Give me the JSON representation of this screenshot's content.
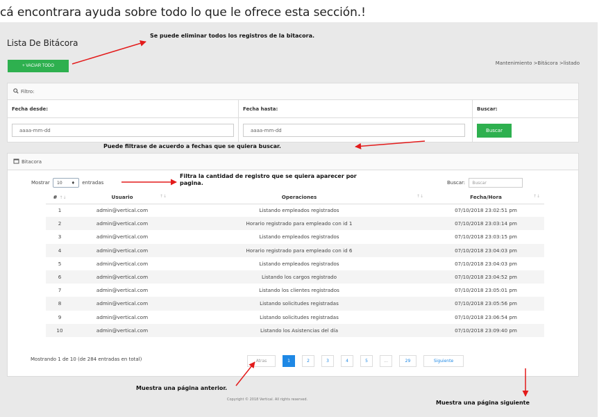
{
  "intro": "cá encontrara ayuda sobre todo lo que le ofrece esta sección.!",
  "page_title": "Lista De Bitácora",
  "vaciar_button": "+ VACIAR TODO",
  "breadcrumb": "Mantenimiento >Bitácora >listado",
  "filter": {
    "header": "Filtro:",
    "col_desde": "Fecha desde:",
    "col_hasta": "Fecha hasta:",
    "col_buscar": "Buscar:",
    "desde_placeholder": "aaaa-mm-dd",
    "hasta_placeholder": "aaaa-mm-dd",
    "buscar_button": "Buscar"
  },
  "bitacora": {
    "header": "Bitacora",
    "mostrar_label": "Mostrar",
    "entries_value": "10",
    "entradas_label": "entradas",
    "buscar_label": "Buscar:",
    "search_placeholder": "Buscar"
  },
  "table": {
    "columns": [
      "#",
      "Usuario",
      "Operaciones",
      "Fecha/Hora"
    ],
    "rows": [
      [
        "1",
        "admin@vertical.com",
        "Listando empleados registrados",
        "07/10/2018 23:02:51 pm"
      ],
      [
        "2",
        "admin@vertical.com",
        "Horario registrado para empleado con id 1",
        "07/10/2018 23:03:14 pm"
      ],
      [
        "3",
        "admin@vertical.com",
        "Listando empleados registrados",
        "07/10/2018 23:03:15 pm"
      ],
      [
        "4",
        "admin@vertical.com",
        "Horario registrado para empleado con id 6",
        "07/10/2018 23:04:03 pm"
      ],
      [
        "5",
        "admin@vertical.com",
        "Listando empleados registrados",
        "07/10/2018 23:04:03 pm"
      ],
      [
        "6",
        "admin@vertical.com",
        "Listando los cargos registrado",
        "07/10/2018 23:04:52 pm"
      ],
      [
        "7",
        "admin@vertical.com",
        "Listando los clientes registrados",
        "07/10/2018 23:05:01 pm"
      ],
      [
        "8",
        "admin@vertical.com",
        "Listando solicitudes registradas",
        "07/10/2018 23:05:56 pm"
      ],
      [
        "9",
        "admin@vertical.com",
        "Listando solicitudes registradas",
        "07/10/2018 23:06:54 pm"
      ],
      [
        "10",
        "admin@vertical.com",
        "Listando los Asistencias del día",
        "07/10/2018 23:09:40 pm"
      ]
    ]
  },
  "info_text": "Mostrando 1 de 10 (de 284 entradas en total)",
  "pagination": {
    "prev": "Atras",
    "pages": [
      "1",
      "2",
      "3",
      "4",
      "5",
      "...",
      "29"
    ],
    "next": "Siguiente",
    "active": "1"
  },
  "annotations": {
    "vaciar": "Se puede eliminar todos los registros de la bitacora.",
    "filtro": "Puede filtrase de acuerdo a fechas que se quiera buscar.",
    "cantidad_line1": "Filtra la cantidad de registro que se quiera aparecer por",
    "cantidad_line2": "pagina.",
    "anterior": "Muestra una página anterior.",
    "siguiente": "Muestra una página siguiente"
  },
  "footer": "Copyright © 2018 Vertical. All rights reserved.",
  "colors": {
    "green": "#2eb04f",
    "blue": "#1e88e5",
    "arrow_red": "#e31b1b"
  }
}
